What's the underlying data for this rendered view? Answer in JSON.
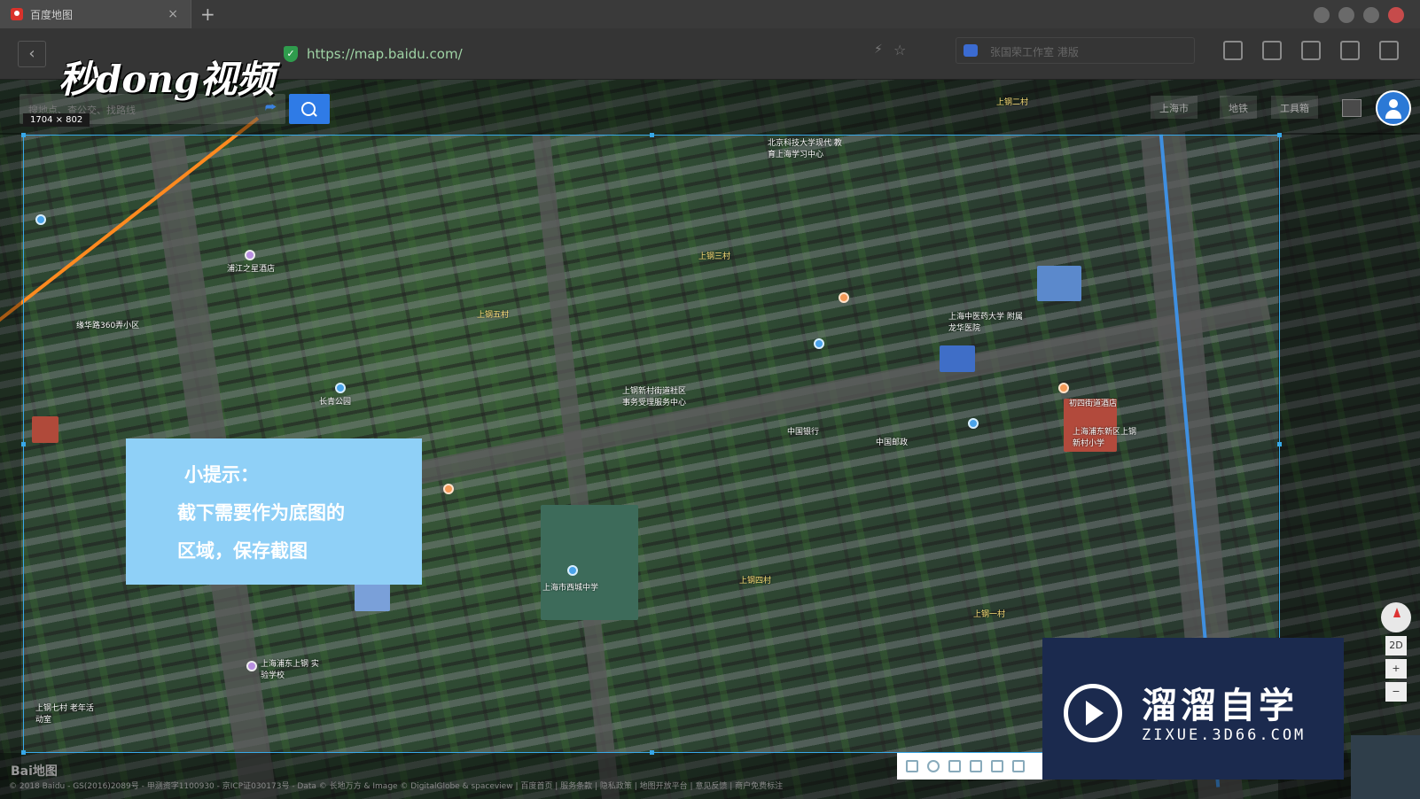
{
  "browser": {
    "tab_title": "百度地图",
    "tab_close": "×",
    "new_tab": "+",
    "back": "‹",
    "url": "https://map.baidu.com/",
    "search_placeholder": "张国荣工作室 港版"
  },
  "watermark": {
    "top_logo": "秒dong视频",
    "brand_cn": "溜溜自学",
    "brand_en": "ZIXUE.3D66.COM"
  },
  "map": {
    "search_placeholder": "搜地点、查公交、找路线",
    "selection_size": "1704 × 802",
    "city": "上海市",
    "subway": "地铁",
    "toolbox": "工具箱",
    "labels": [
      {
        "text": "上钢三村"
      },
      {
        "text": "上钢五村"
      },
      {
        "text": "上钢四村"
      },
      {
        "text": "上钢一村"
      },
      {
        "text": "上钢二村"
      },
      {
        "text": "上钢七村 老年活动室"
      },
      {
        "text": "长青公园"
      },
      {
        "text": "中国银行"
      },
      {
        "text": "中国邮政"
      },
      {
        "text": "上海市西城中学"
      },
      {
        "text": "浦江之星酒店"
      },
      {
        "text": "上海中医药大学 附属龙华医院"
      },
      {
        "text": "北京科技大学现代 教育上海学习中心"
      },
      {
        "text": "缘华路360弄小区"
      },
      {
        "text": "上钢新村街道社区 事务受理服务中心"
      },
      {
        "text": "上海浦东上钢 实验学校"
      },
      {
        "text": "初四街道酒店"
      },
      {
        "text": "上海浦东新区上钢 新村小学"
      }
    ],
    "footer": "© 2018 Baidu - GS(2016)2089号 - 甲测资字1100930 - 京ICP证030173号 - Data © 长地万方 & Image © DigitalGlobe & spaceview | 百度首页 | 服务条款 | 隐私政策 | 地图开放平台 | 意见反馈 | 商户免费标注",
    "baidu_logo": "Bai地图",
    "controls": {
      "view_2d": "2D",
      "zoom_in": "+",
      "zoom_out": "−"
    }
  },
  "tip": {
    "title": "小提示：",
    "line1": "截下需要作为底图的",
    "line2": "区域，保存截图"
  }
}
